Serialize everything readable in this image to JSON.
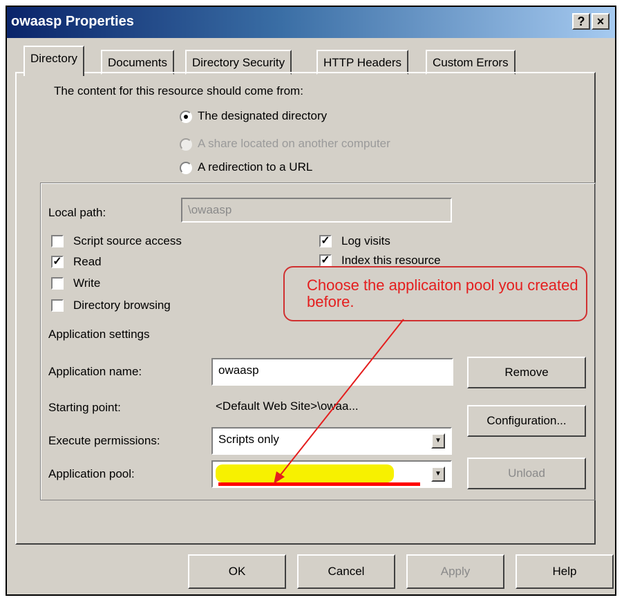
{
  "window": {
    "title": "owaasp Properties",
    "help_button": "?",
    "close_button": "×"
  },
  "tabs": [
    {
      "label": "Directory"
    },
    {
      "label": "Documents"
    },
    {
      "label": "Directory Security"
    },
    {
      "label": "HTTP Headers"
    },
    {
      "label": "Custom Errors"
    }
  ],
  "content_source": {
    "prompt": "The content for this resource should come from:",
    "options": [
      {
        "label": "The designated directory",
        "selected": true,
        "enabled": true
      },
      {
        "label": "A share located on another computer",
        "selected": false,
        "enabled": false
      },
      {
        "label": "A redirection to a URL",
        "selected": false,
        "enabled": true
      }
    ]
  },
  "local_path": {
    "label": "Local path:",
    "value": "\\owaasp"
  },
  "checkboxes_left": [
    {
      "label": "Script source access",
      "checked": false
    },
    {
      "label": "Read",
      "checked": true
    },
    {
      "label": "Write",
      "checked": false
    },
    {
      "label": "Directory browsing",
      "checked": false
    }
  ],
  "checkboxes_right": [
    {
      "label": "Log visits",
      "checked": true
    },
    {
      "label": "Index this resource",
      "checked": true
    }
  ],
  "application_settings": {
    "heading": "Application settings",
    "app_name_label": "Application name:",
    "app_name_value": "owaasp",
    "starting_point_label": "Starting point:",
    "starting_point_value": "<Default Web Site>\\owaa...",
    "execute_label": "Execute permissions:",
    "execute_value": "Scripts only",
    "pool_label": "Application pool:",
    "pool_value": ""
  },
  "side_buttons": {
    "remove": "Remove",
    "configuration": "Configuration...",
    "unload": "Unload"
  },
  "annotation": {
    "text": "Choose the applicaiton pool you created before.",
    "color": "#e41e1e"
  },
  "footer_buttons": {
    "ok": "OK",
    "cancel": "Cancel",
    "apply": "Apply",
    "help": "Help"
  }
}
